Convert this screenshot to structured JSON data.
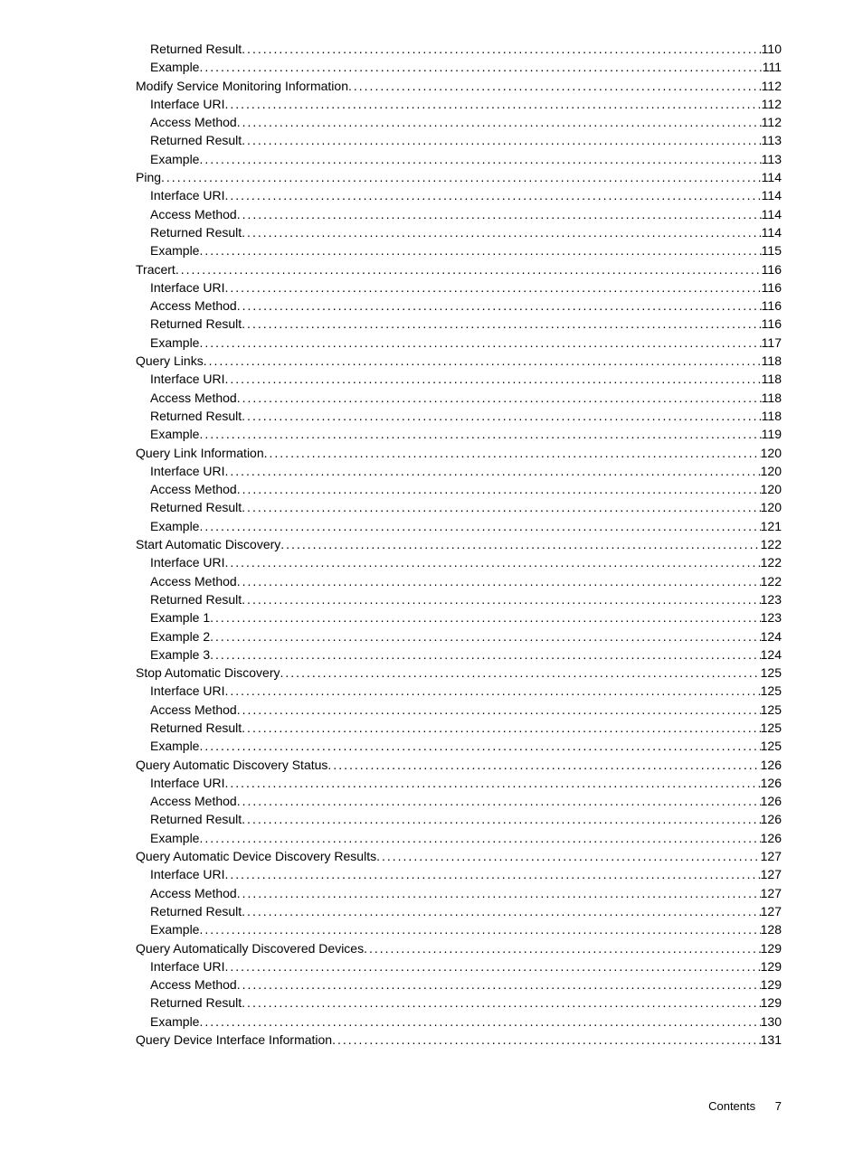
{
  "toc": [
    {
      "level": 3,
      "title": "Returned Result",
      "page": "110"
    },
    {
      "level": 3,
      "title": "Example",
      "page": "111"
    },
    {
      "level": 2,
      "title": "Modify Service Monitoring Information",
      "page": "112"
    },
    {
      "level": 3,
      "title": "Interface URI",
      "page": "112"
    },
    {
      "level": 3,
      "title": "Access Method",
      "page": "112"
    },
    {
      "level": 3,
      "title": "Returned Result",
      "page": "113"
    },
    {
      "level": 3,
      "title": "Example",
      "page": "113"
    },
    {
      "level": 2,
      "title": "Ping",
      "page": "114"
    },
    {
      "level": 3,
      "title": "Interface URI",
      "page": "114"
    },
    {
      "level": 3,
      "title": "Access Method",
      "page": "114"
    },
    {
      "level": 3,
      "title": "Returned Result",
      "page": "114"
    },
    {
      "level": 3,
      "title": "Example",
      "page": "115"
    },
    {
      "level": 2,
      "title": "Tracert",
      "page": "116"
    },
    {
      "level": 3,
      "title": "Interface URI",
      "page": "116"
    },
    {
      "level": 3,
      "title": "Access Method",
      "page": "116"
    },
    {
      "level": 3,
      "title": "Returned Result",
      "page": "116"
    },
    {
      "level": 3,
      "title": "Example",
      "page": "117"
    },
    {
      "level": 2,
      "title": "Query Links",
      "page": "118"
    },
    {
      "level": 3,
      "title": "Interface URI",
      "page": "118"
    },
    {
      "level": 3,
      "title": "Access Method",
      "page": "118"
    },
    {
      "level": 3,
      "title": "Returned Result",
      "page": "118"
    },
    {
      "level": 3,
      "title": "Example",
      "page": "119"
    },
    {
      "level": 2,
      "title": "Query Link Information",
      "page": "120"
    },
    {
      "level": 3,
      "title": "Interface URI",
      "page": "120"
    },
    {
      "level": 3,
      "title": "Access Method",
      "page": "120"
    },
    {
      "level": 3,
      "title": "Returned Result",
      "page": "120"
    },
    {
      "level": 3,
      "title": "Example",
      "page": "121"
    },
    {
      "level": 2,
      "title": "Start Automatic Discovery",
      "page": "122"
    },
    {
      "level": 3,
      "title": "Interface URI",
      "page": "122"
    },
    {
      "level": 3,
      "title": "Access Method",
      "page": "122"
    },
    {
      "level": 3,
      "title": "Returned Result",
      "page": "123"
    },
    {
      "level": 3,
      "title": "Example 1",
      "page": "123"
    },
    {
      "level": 3,
      "title": "Example 2",
      "page": "124"
    },
    {
      "level": 3,
      "title": "Example 3",
      "page": "124"
    },
    {
      "level": 2,
      "title": "Stop Automatic Discovery",
      "page": "125"
    },
    {
      "level": 3,
      "title": "Interface URI",
      "page": "125"
    },
    {
      "level": 3,
      "title": "Access Method",
      "page": "125"
    },
    {
      "level": 3,
      "title": "Returned Result",
      "page": "125"
    },
    {
      "level": 3,
      "title": "Example",
      "page": "125"
    },
    {
      "level": 2,
      "title": "Query Automatic Discovery Status",
      "page": "126"
    },
    {
      "level": 3,
      "title": "Interface URI",
      "page": "126"
    },
    {
      "level": 3,
      "title": "Access Method",
      "page": "126"
    },
    {
      "level": 3,
      "title": "Returned Result",
      "page": "126"
    },
    {
      "level": 3,
      "title": "Example",
      "page": "126"
    },
    {
      "level": 2,
      "title": "Query Automatic Device Discovery Results",
      "page": "127"
    },
    {
      "level": 3,
      "title": "Interface URI",
      "page": "127"
    },
    {
      "level": 3,
      "title": "Access Method",
      "page": "127"
    },
    {
      "level": 3,
      "title": "Returned Result",
      "page": "127"
    },
    {
      "level": 3,
      "title": "Example",
      "page": "128"
    },
    {
      "level": 2,
      "title": "Query Automatically Discovered Devices",
      "page": "129"
    },
    {
      "level": 3,
      "title": "Interface URI",
      "page": "129"
    },
    {
      "level": 3,
      "title": "Access Method",
      "page": "129"
    },
    {
      "level": 3,
      "title": "Returned Result",
      "page": "129"
    },
    {
      "level": 3,
      "title": "Example",
      "page": "130"
    },
    {
      "level": 2,
      "title": "Query Device Interface Information",
      "page": "131"
    }
  ],
  "footer": {
    "label": "Contents",
    "page": "7"
  }
}
